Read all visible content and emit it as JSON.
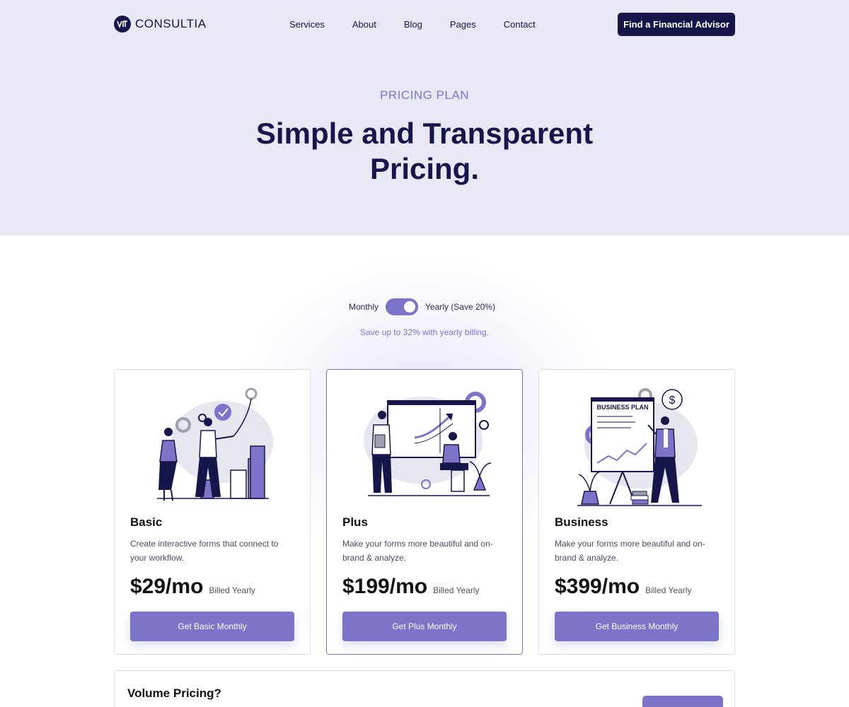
{
  "header": {
    "brand": "CONSULTIA",
    "nav": [
      "Services",
      "About",
      "Blog",
      "Pages",
      "Contact"
    ],
    "cta_label": "Find a Financial Advisor"
  },
  "hero": {
    "eyebrow": "PRICING PLAN",
    "title": "Simple and Transparent Pricing."
  },
  "billing_toggle": {
    "monthly_label": "Monthly",
    "yearly_label": "Yearly (Save 20%)",
    "state": "yearly",
    "note": "Save up to 32% with yearly billing."
  },
  "plans": [
    {
      "name": "Basic",
      "description": "Create interactive forms that connect to your workflow.",
      "price": "$29/mo",
      "billing": "Billed Yearly",
      "button": "Get Basic Monthly",
      "illustration": "team-growth-chart-illustration"
    },
    {
      "name": "Plus",
      "description": "Make your forms more beautiful and on-brand & analyze.",
      "price": "$199/mo",
      "billing": "Billed Yearly",
      "button": "Get Plus Monthly",
      "illustration": "presentation-meeting-illustration",
      "featured": true
    },
    {
      "name": "Business",
      "description": "Make your forms more beautiful and on-brand & analyze.",
      "price": "$399/mo",
      "billing": "Billed Yearly",
      "button": "Get Business Monthly",
      "illustration": "business-plan-board-illustration",
      "board_title": "BUSINESS PLAN",
      "bubble_symbol": "$"
    }
  ],
  "volume": {
    "title": "Volume Pricing?"
  },
  "colors": {
    "navy": "#16164a",
    "accent": "#7b74c8",
    "accent_text": "#7b74d2",
    "hero_bg": "#e8e8f5",
    "border": "#dddde6"
  }
}
